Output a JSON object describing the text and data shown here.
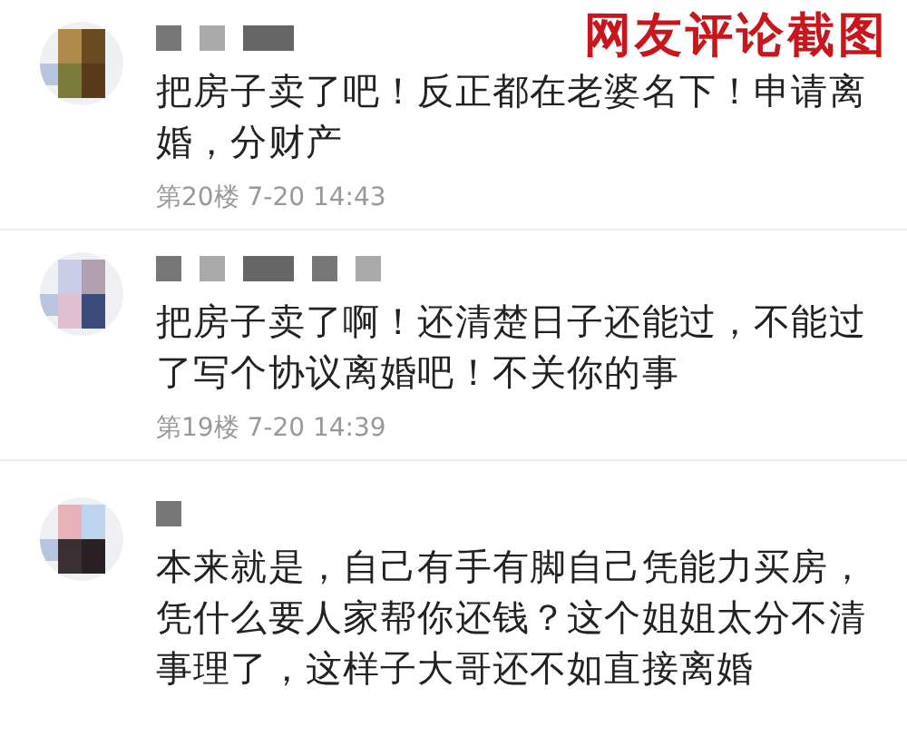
{
  "caption": "网友评论截图",
  "comments": [
    {
      "text": "把房子卖了吧！反正都在老婆名下！申请离婚，分财产",
      "meta": "第20楼 7-20 14:43"
    },
    {
      "text": "把房子卖了啊！还清楚日子还能过，不能过了写个协议离婚吧！不关你的事",
      "meta": "第19楼 7-20 14:39"
    },
    {
      "text": "本来就是，自己有手有脚自己凭能力买房，凭什么要人家帮你还钱？这个姐姐太分不清事理了，这样子大哥还不如直接离婚"
    }
  ]
}
